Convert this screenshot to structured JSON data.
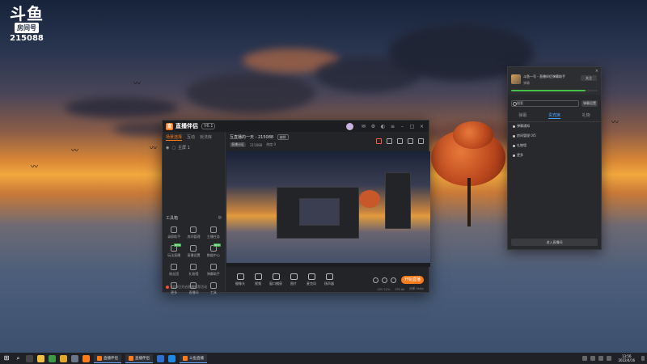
{
  "watermark": {
    "brand": "斗鱼",
    "room_label": "房间号",
    "room_number": "215088"
  },
  "app": {
    "name": "直播伴侣",
    "version": "V6.1",
    "left_tabs": [
      "场景选择",
      "互动",
      "玩法库"
    ],
    "scene_label": "主屏 1",
    "tools_title": "工具箱",
    "tools": [
      {
        "label": "录屏助手",
        "icon": "record-icon",
        "badge": ""
      },
      {
        "label": "房间管理",
        "icon": "room-manage-icon",
        "badge": ""
      },
      {
        "label": "主播任务",
        "icon": "task-icon",
        "badge": ""
      },
      {
        "label": "玩法直播",
        "icon": "play-icon",
        "badge": "NEW"
      },
      {
        "label": "直播设置",
        "icon": "settings-icon",
        "badge": ""
      },
      {
        "label": "数据中心",
        "icon": "data-icon",
        "badge": "NEW"
      },
      {
        "label": "粉丝团",
        "icon": "fans-icon",
        "badge": ""
      },
      {
        "label": "礼物墙",
        "icon": "gift-icon",
        "badge": ""
      },
      {
        "label": "弹幕助手",
        "icon": "danmu-icon",
        "badge": ""
      },
      {
        "label": "更多",
        "icon": "more-icon",
        "badge": ""
      },
      {
        "label": "直播间",
        "icon": "live-room-icon",
        "badge": ""
      },
      {
        "label": "工具",
        "icon": "tools-icon",
        "badge": ""
      }
    ],
    "notice_text": "8月9日开启直播推荐活动",
    "room_title": "互直播的一天 - 215088",
    "room_tag": "编辑",
    "room_meta": {
      "category": "直播分区",
      "viewers": "215088",
      "popularity": "热度 0"
    },
    "controls": [
      {
        "label": "摄像头",
        "icon": "camera-icon"
      },
      {
        "label": "视频",
        "icon": "video-icon"
      },
      {
        "label": "窗口捕获",
        "icon": "window-capture-icon"
      },
      {
        "label": "图片",
        "icon": "image-icon"
      },
      {
        "label": "麦克风",
        "icon": "mic-icon"
      },
      {
        "label": "扬声器",
        "icon": "speaker-icon"
      }
    ],
    "live_button": "开始直播",
    "status": [
      "CPU 12%",
      "FPS 60",
      "码率 0kb/s"
    ]
  },
  "chat": {
    "close_glyph": "×",
    "room_name": "斗鱼一号 - 直播伴侣弹幕助手",
    "room_sub": "弹幕",
    "follow_label": "关注",
    "level_start": "LV 1",
    "level_end": "LV 2",
    "level_progress": 0.86,
    "search_placeholder": "搜索",
    "search_button": "弹幕设置",
    "tabs": [
      "弹幕",
      "贵宾席",
      "礼物"
    ],
    "active_tab": 1,
    "items": [
      "弹幕通知",
      "房间管理 0/5",
      "礼物墙",
      "更多"
    ],
    "bottom_button": "进入直播间"
  },
  "taskbar": {
    "tasks": [
      {
        "label": "直播伴侣",
        "color": "#ff7a18"
      },
      {
        "label": "直播伴侣",
        "color": "#ff7a18"
      },
      {
        "label": "斗鱼直播",
        "color": "#ff7a18"
      }
    ],
    "time": "13:56",
    "date": "2022/4/16"
  },
  "colors": {
    "accent": "#ff7a18",
    "green": "#3db24a",
    "blue": "#48a0ff"
  }
}
